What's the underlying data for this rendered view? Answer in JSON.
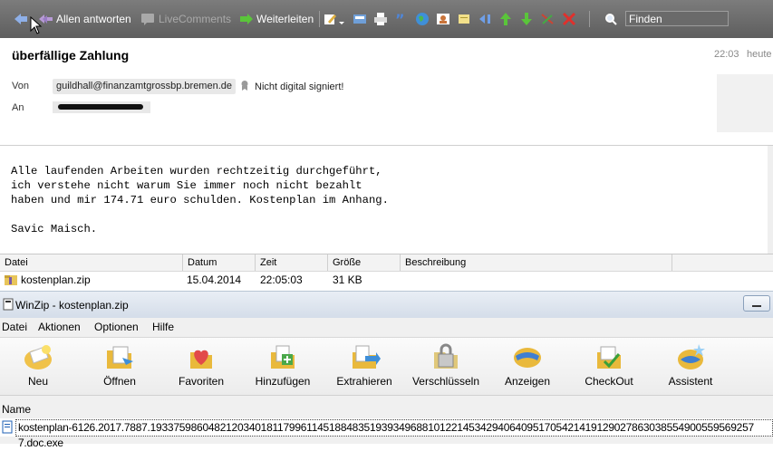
{
  "toolbar": {
    "reply_all_label": "Allen antworten",
    "livecomments_label": "LiveComments",
    "forward_label": "Weiterleiten",
    "search_placeholder": "Finden"
  },
  "message": {
    "subject": "überfällige Zahlung",
    "time": "22:03",
    "day": "heute",
    "from_label": "Von",
    "from_address": "guildhall@finanzamtgrossbp.bremen.de",
    "to_label": "An",
    "signature_status": "Nicht digital signiert!",
    "body_lines": [
      "Alle laufenden Arbeiten wurden rechtzeitig durchgeführt,",
      "ich verstehe nicht warum Sie immer noch nicht bezahlt",
      "haben und mir 174.71 euro schulden. Kostenplan im Anhang.",
      "",
      "Savic Maisch."
    ]
  },
  "attachments": {
    "columns": [
      "Datei",
      "Datum",
      "Zeit",
      "Größe",
      "Beschreibung"
    ],
    "rows": [
      {
        "name": "kostenplan.zip",
        "date": "15.04.2014",
        "time": "22:05:03",
        "size": "31 KB",
        "description": ""
      }
    ]
  },
  "winzip": {
    "title": "WinZip - kostenplan.zip",
    "menu": [
      "Datei",
      "Aktionen",
      "Optionen",
      "Hilfe"
    ],
    "tools": [
      {
        "label": "Neu",
        "icon": "new-archive-icon"
      },
      {
        "label": "Öffnen",
        "icon": "open-archive-icon"
      },
      {
        "label": "Favoriten",
        "icon": "favorites-icon"
      },
      {
        "label": "Hinzufügen",
        "icon": "add-icon"
      },
      {
        "label": "Extrahieren",
        "icon": "extract-icon"
      },
      {
        "label": "Verschlüsseln",
        "icon": "encrypt-icon"
      },
      {
        "label": "Anzeigen",
        "icon": "view-icon"
      },
      {
        "label": "CheckOut",
        "icon": "checkout-icon"
      },
      {
        "label": "Assistent",
        "icon": "wizard-icon"
      }
    ],
    "column_name": "Name",
    "file_name": "kostenplan-6126.2017.7887.19337598604821203401811799611451884835193934968810122145342940640951705421419129027863038554900559569257 7.doc.exe",
    "colors": {
      "accent": "#1e5fb4",
      "toolbar_bg": "#6b6b6b"
    }
  }
}
